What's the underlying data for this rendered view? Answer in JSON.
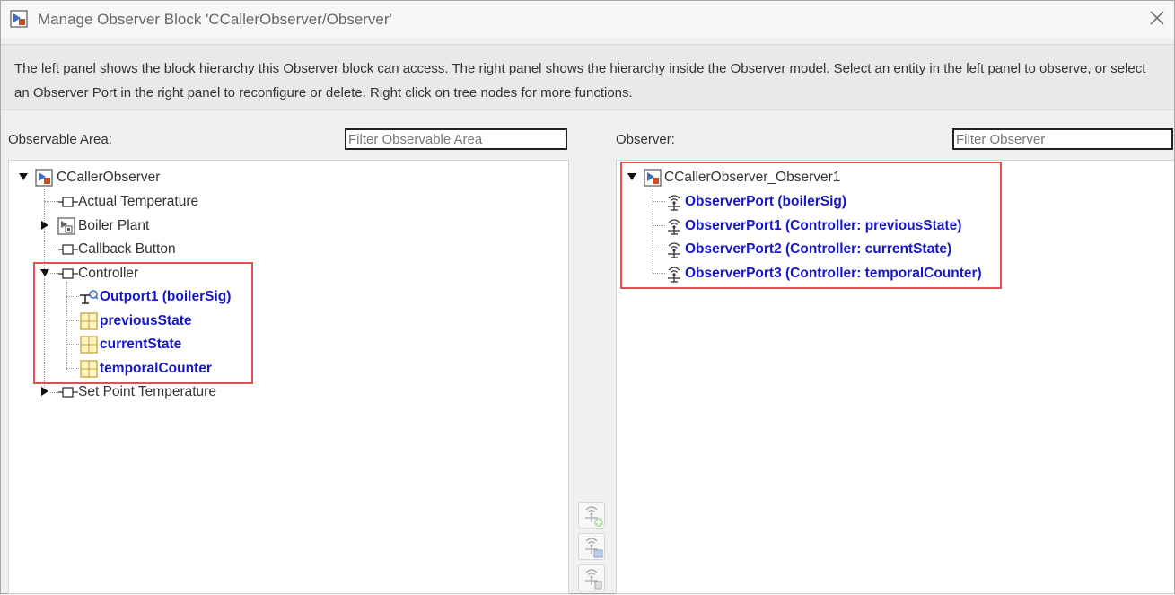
{
  "window": {
    "title": "Manage Observer Block 'CCallerObserver/Observer'",
    "description": "The left panel shows the block hierarchy this Observer block can access. The right panel shows the hierarchy inside the Observer model. Select an entity in the left panel to observe, or select an Observer Port in the right panel to reconfigure or delete. Right click on tree nodes for more functions."
  },
  "left": {
    "label": "Observable Area:",
    "filter_placeholder": "Filter Observable Area",
    "tree": {
      "root": "CCallerObserver",
      "actual_temperature": "Actual Temperature",
      "boiler_plant": "Boiler Plant",
      "callback_button": "Callback Button",
      "controller": "Controller",
      "outport1": "Outport1 (boilerSig)",
      "previous_state": "previousState",
      "current_state": "currentState",
      "temporal_counter": "temporalCounter",
      "set_point_temperature": "Set Point Temperature"
    }
  },
  "right": {
    "label": "Observer:",
    "filter_placeholder": "Filter Observer",
    "tree": {
      "root": "CCallerObserver_Observer1",
      "ports": [
        "ObserverPort (boilerSig)",
        "ObserverPort1 (Controller: previousState)",
        "ObserverPort2 (Controller: currentState)",
        "ObserverPort3 (Controller: temporalCounter)"
      ]
    }
  },
  "icons": {
    "app": "simulink-model-icon",
    "close": "close-icon",
    "add": "add-observer-port-icon",
    "configure": "configure-observer-port-icon",
    "delete": "delete-observer-port-icon"
  },
  "colors": {
    "link": "#1717c4",
    "highlight": "#e05050"
  }
}
